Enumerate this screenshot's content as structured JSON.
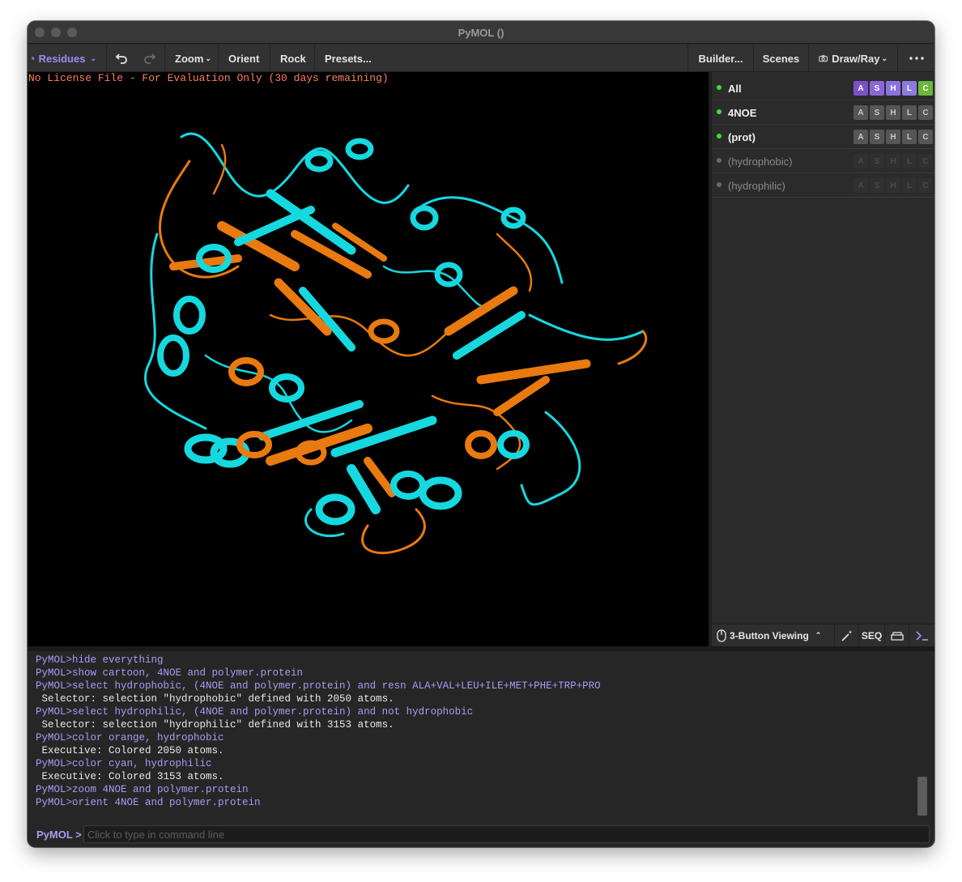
{
  "window": {
    "title": "PyMOL ()"
  },
  "toolbar": {
    "mouse_mode": "Residues",
    "zoom": "Zoom",
    "orient": "Orient",
    "rock": "Rock",
    "presets": "Presets...",
    "builder": "Builder...",
    "scenes": "Scenes",
    "draw_ray": "Draw/Ray"
  },
  "viewport": {
    "license_notice": "No License File - For Evaluation Only (30 days remaining)"
  },
  "objects": [
    {
      "name": "All",
      "enabled": true,
      "buttons": [
        "A",
        "S",
        "H",
        "L",
        "C"
      ]
    },
    {
      "name": "4NOE",
      "enabled": true,
      "buttons": [
        "A",
        "S",
        "H",
        "L",
        "C"
      ]
    },
    {
      "name": "(prot)",
      "enabled": true,
      "buttons": [
        "A",
        "S",
        "H",
        "L",
        "C"
      ]
    },
    {
      "name": "(hydrophobic)",
      "enabled": false,
      "buttons": [
        "A",
        "S",
        "H",
        "L",
        "C"
      ]
    },
    {
      "name": "(hydrophilic)",
      "enabled": false,
      "buttons": [
        "A",
        "S",
        "H",
        "L",
        "C"
      ]
    }
  ],
  "bottom_bar": {
    "viewing_mode": "3-Button Viewing",
    "seq": "SEQ"
  },
  "console": {
    "lines": [
      {
        "kind": "cmd",
        "text": "PyMOL>hide everything"
      },
      {
        "kind": "cmd",
        "text": "PyMOL>show cartoon, 4NOE and polymer.protein"
      },
      {
        "kind": "cmd",
        "text": "PyMOL>select hydrophobic, (4NOE and polymer.protein) and resn ALA+VAL+LEU+ILE+MET+PHE+TRP+PRO"
      },
      {
        "kind": "out",
        "text": " Selector: selection \"hydrophobic\" defined with 2050 atoms."
      },
      {
        "kind": "cmd",
        "text": "PyMOL>select hydrophilic, (4NOE and polymer.protein) and not hydrophobic"
      },
      {
        "kind": "out",
        "text": " Selector: selection \"hydrophilic\" defined with 3153 atoms."
      },
      {
        "kind": "cmd",
        "text": "PyMOL>color orange, hydrophobic"
      },
      {
        "kind": "out",
        "text": " Executive: Colored 2050 atoms."
      },
      {
        "kind": "cmd",
        "text": "PyMOL>color cyan, hydrophilic"
      },
      {
        "kind": "out",
        "text": " Executive: Colored 3153 atoms."
      },
      {
        "kind": "cmd",
        "text": "PyMOL>zoom 4NOE and polymer.protein"
      },
      {
        "kind": "cmd",
        "text": "PyMOL>orient 4NOE and polymer.protein"
      }
    ]
  },
  "command_line": {
    "prompt": "PyMOL >",
    "placeholder": "Click to type in command line"
  },
  "colors": {
    "accent": "#9b8cf2",
    "hydrophobic": "#e87a10",
    "hydrophilic": "#16d8df",
    "enabled_dot": "#3ddc3d"
  },
  "icons": [
    "cursor-arrow-icon",
    "undo-icon",
    "redo-icon",
    "camera-icon",
    "more-icon",
    "mouse-icon",
    "wand-icon",
    "sofa-icon",
    "terminal-icon"
  ]
}
